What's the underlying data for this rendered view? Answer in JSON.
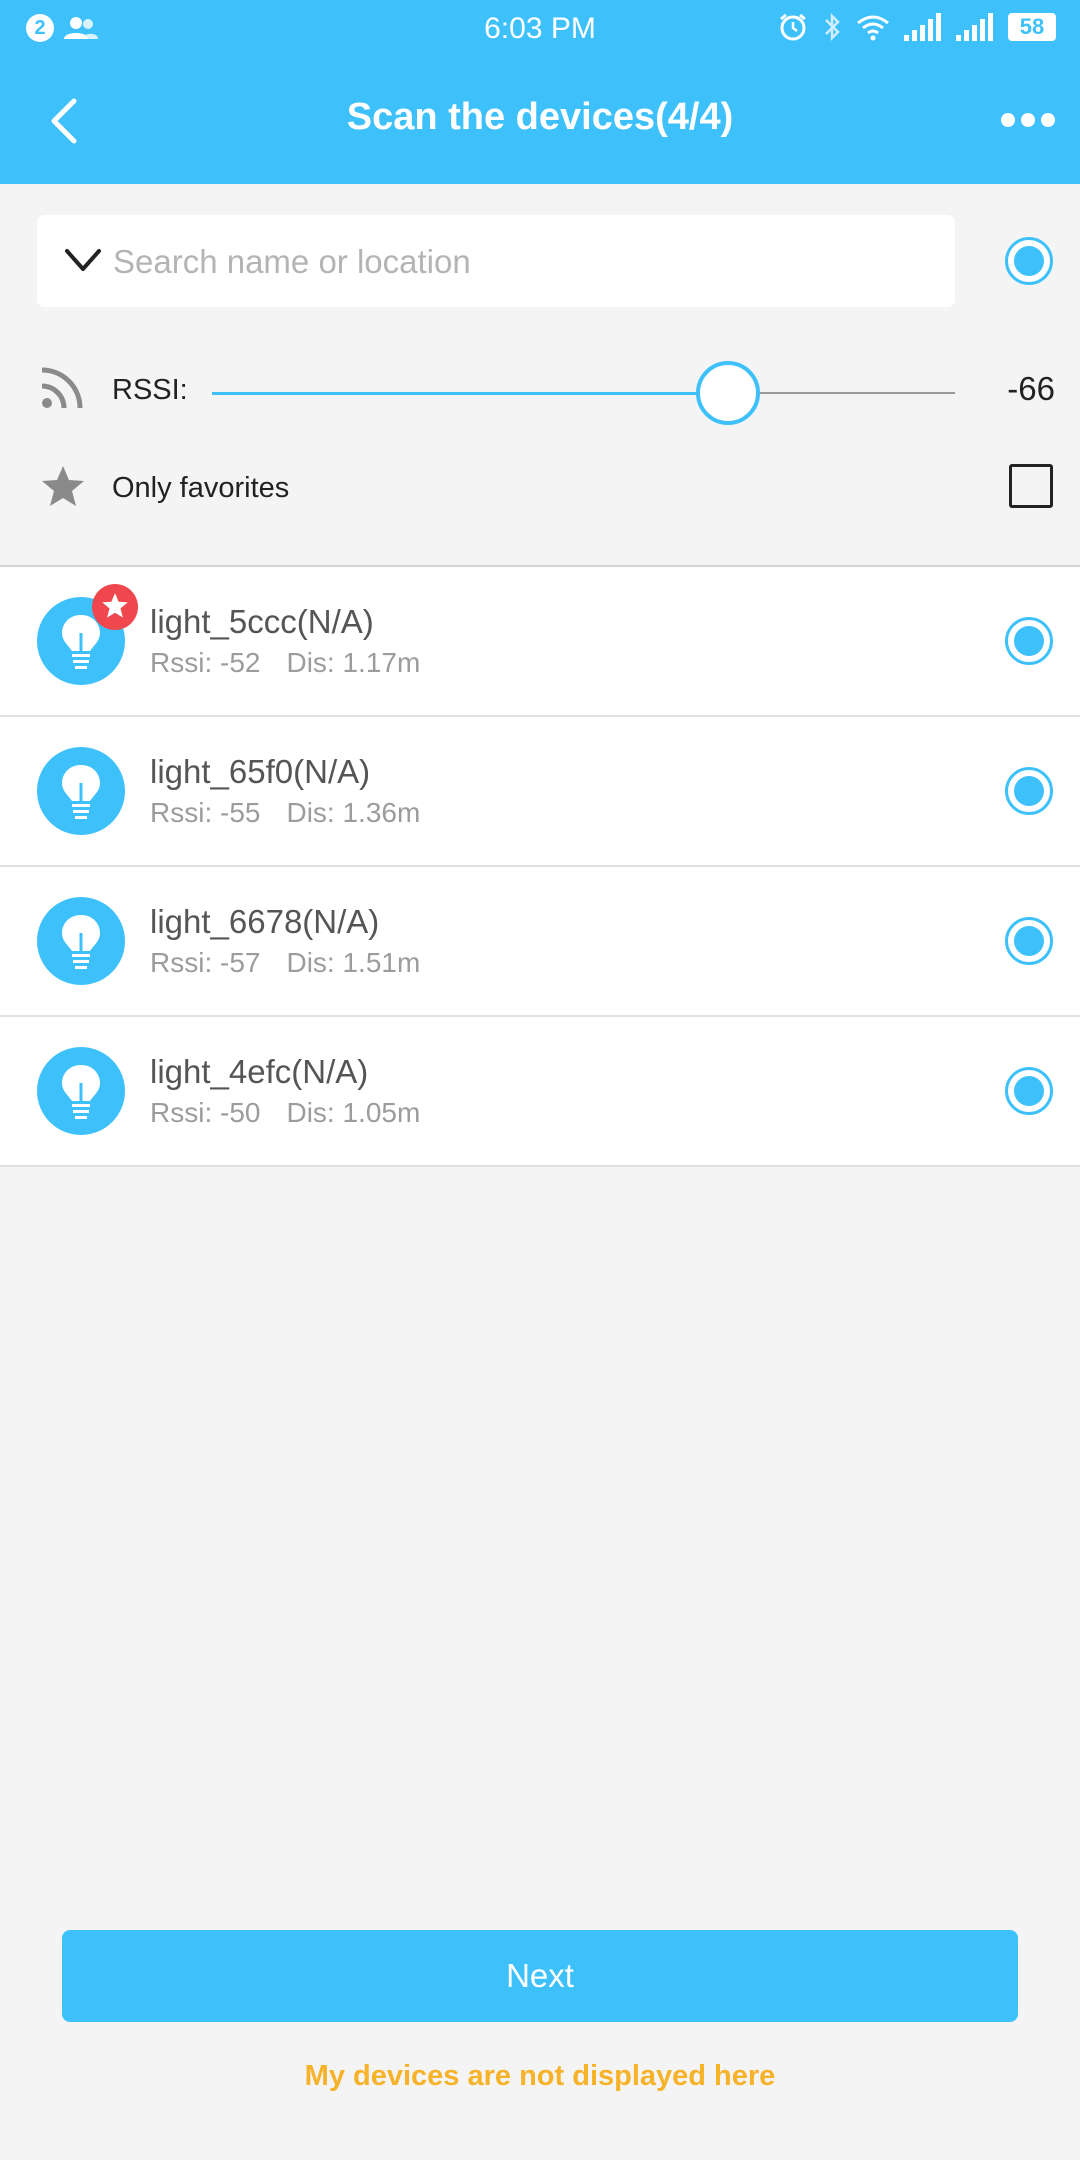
{
  "status_bar": {
    "notification_count": "2",
    "time": "6:03 PM",
    "battery": "58",
    "icons": [
      "contacts-icon",
      "alarm-icon",
      "bluetooth-icon",
      "wifi-icon",
      "signal-icon",
      "signal-icon"
    ]
  },
  "header": {
    "title": "Scan the devices(4/4)",
    "back_icon": "chevron-left-icon",
    "more_icon": "more-horizontal-icon"
  },
  "search": {
    "placeholder": "Search name or location",
    "value": "",
    "select_all_checked": true
  },
  "rssi": {
    "label": "RSSI:",
    "value": "-66",
    "slider_fraction": 0.69
  },
  "favorites": {
    "label": "Only favorites",
    "checked": false
  },
  "devices": [
    {
      "name": "light_5ccc(N/A)",
      "rssi": "Rssi: -52",
      "dis": "Dis: 1.17m",
      "favorite": true,
      "selected": true
    },
    {
      "name": "light_65f0(N/A)",
      "rssi": "Rssi: -55",
      "dis": "Dis: 1.36m",
      "favorite": false,
      "selected": true
    },
    {
      "name": "light_6678(N/A)",
      "rssi": "Rssi: -57",
      "dis": "Dis: 1.51m",
      "favorite": false,
      "selected": true
    },
    {
      "name": "light_4efc(N/A)",
      "rssi": "Rssi: -50",
      "dis": "Dis: 1.05m",
      "favorite": false,
      "selected": true
    }
  ],
  "footer": {
    "next_label": "Next",
    "not_displayed_link": "My devices are not displayed here"
  },
  "colors": {
    "primary": "#3ec1fb",
    "favorite_badge": "#f0474f",
    "link": "#f6b229"
  }
}
